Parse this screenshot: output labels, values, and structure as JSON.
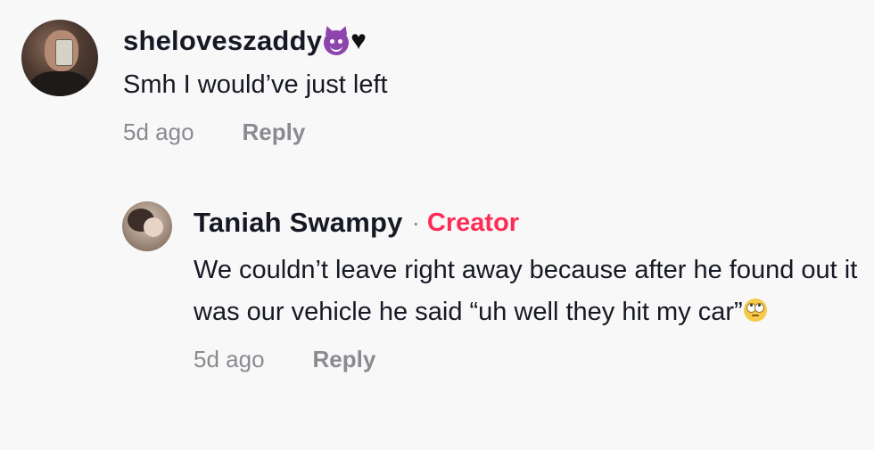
{
  "comment": {
    "username": "sheloveszaddy",
    "username_emojis": [
      "devil-emoji",
      "black-heart-emoji"
    ],
    "text": "Smh I would’ve just left",
    "time": "5d ago",
    "reply_label": "Reply"
  },
  "reply": {
    "username": "Taniah Swampy",
    "separator": "·",
    "badge": "Creator",
    "text": "We couldn’t leave right away because after he found out it was our vehicle he said “uh well they hit my car”",
    "trailing_emoji": "face-with-rolling-eyes-emoji",
    "time": "5d ago",
    "reply_label": "Reply"
  },
  "colors": {
    "background": "#f8f8f8",
    "text": "#161823",
    "muted": "#8a8b91",
    "creator_accent": "#fe2c55"
  }
}
